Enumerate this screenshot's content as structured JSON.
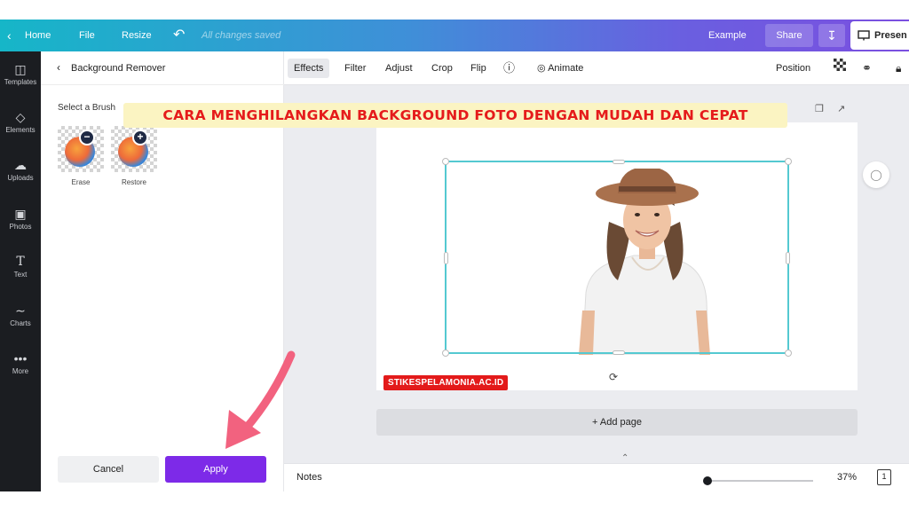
{
  "topbar": {
    "back_icon": "chevron-left-icon",
    "home": "Home",
    "file": "File",
    "resize": "Resize",
    "undo_icon": "undo-icon",
    "saved_status": "All changes saved",
    "example": "Example",
    "share": "Share",
    "download_icon": "download-icon",
    "present": "Presen"
  },
  "rail": {
    "items": [
      {
        "label": "Templates",
        "icon": "templates-icon"
      },
      {
        "label": "Elements",
        "icon": "elements-icon"
      },
      {
        "label": "Uploads",
        "icon": "uploads-icon"
      },
      {
        "label": "Photos",
        "icon": "photos-icon"
      },
      {
        "label": "Text",
        "icon": "text-icon"
      },
      {
        "label": "Charts",
        "icon": "charts-icon"
      },
      {
        "label": "More",
        "icon": "more-icon"
      }
    ]
  },
  "panel": {
    "title": "Background Remover",
    "brush_label": "Select a Brush",
    "brushes": [
      {
        "label": "Erase",
        "badge": "−"
      },
      {
        "label": "Restore",
        "badge": "+"
      }
    ],
    "cancel": "Cancel",
    "apply": "Apply"
  },
  "toolbar": {
    "effects": "Effects",
    "filter": "Filter",
    "adjust": "Adjust",
    "crop": "Crop",
    "flip": "Flip",
    "animate": "Animate",
    "position": "Position"
  },
  "canvas": {
    "add_page": "+ Add page"
  },
  "bottom": {
    "notes": "Notes",
    "zoom": "37%",
    "zoom_fraction": 0.37,
    "page_number": "1"
  },
  "overlay": {
    "banner": "CARA MENGHILANGKAN BACKGROUND FOTO DENGAN MUDAH DAN CEPAT",
    "watermark": "STIKESPELAMONIA.AC.ID"
  },
  "colors": {
    "accent_purple": "#7d2ae8",
    "banner_text": "#e51b1b",
    "selection": "#54c9d1",
    "arrow": "#f2627f"
  }
}
